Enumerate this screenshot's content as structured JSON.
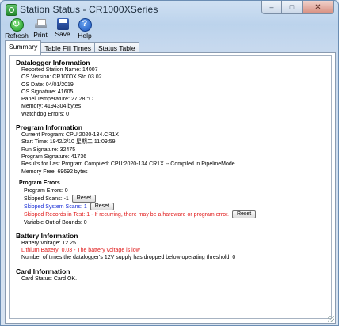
{
  "window": {
    "title": "Station Status - CR1000XSeries",
    "controls": {
      "minimize": "–",
      "maximize": "□",
      "close": "✕"
    }
  },
  "toolbar": {
    "refresh": "Refresh",
    "print": "Print",
    "save": "Save",
    "help": "Help"
  },
  "tabs": [
    {
      "label": "Summary",
      "active": true
    },
    {
      "label": "Table Fill Times",
      "active": false
    },
    {
      "label": "Status Table",
      "active": false
    }
  ],
  "datalogger": {
    "heading": "Datalogger Information",
    "lines": [
      "Reported Station Name: 14007",
      "OS Version: CR1000X.Std.03.02",
      "OS Date: 04/01/2019",
      "OS Signature: 41605",
      "Panel Temperature: 27.28 °C",
      "Memory: 4194304 bytes",
      "Watchdog Errors: 0"
    ]
  },
  "program": {
    "heading": "Program Information",
    "lines": [
      "Current Program: CPU:2020-134.CR1X",
      "Start Time: 1942/2/10 星期二 11:09:59",
      "Run Signature: 32475",
      "Program Signature: 41736",
      "Results for Last Program Compiled: CPU:2020-134.CR1X -- Compiled in PipelineMode.",
      "Memory Free: 69692 bytes"
    ]
  },
  "program_errors": {
    "heading": "Program Errors",
    "program_errors": "Program Errors: 0",
    "skipped_scans": "Skipped Scans: -1",
    "skipped_system_scans": "Skipped System Scans: 1",
    "skipped_records": "Skipped Records in Test: 1 - If recurring, there may be a hardware or program error.",
    "variable_out_of_bounds": "Variable Out of Bounds: 0",
    "reset_label": "Reset"
  },
  "battery": {
    "heading": "Battery Information",
    "voltage": "Battery Voltage: 12.25",
    "lithium": "Lithium Battery: 0.03 - The battery voltage is low",
    "drops": "Number of times the datalogger's 12V supply has dropped below operating threshold: 0"
  },
  "card": {
    "heading": "Card Information",
    "status": "Card Status: Card OK."
  },
  "colors": {
    "error": "#e01a1a",
    "warning_blue": "#1a2fd6"
  }
}
